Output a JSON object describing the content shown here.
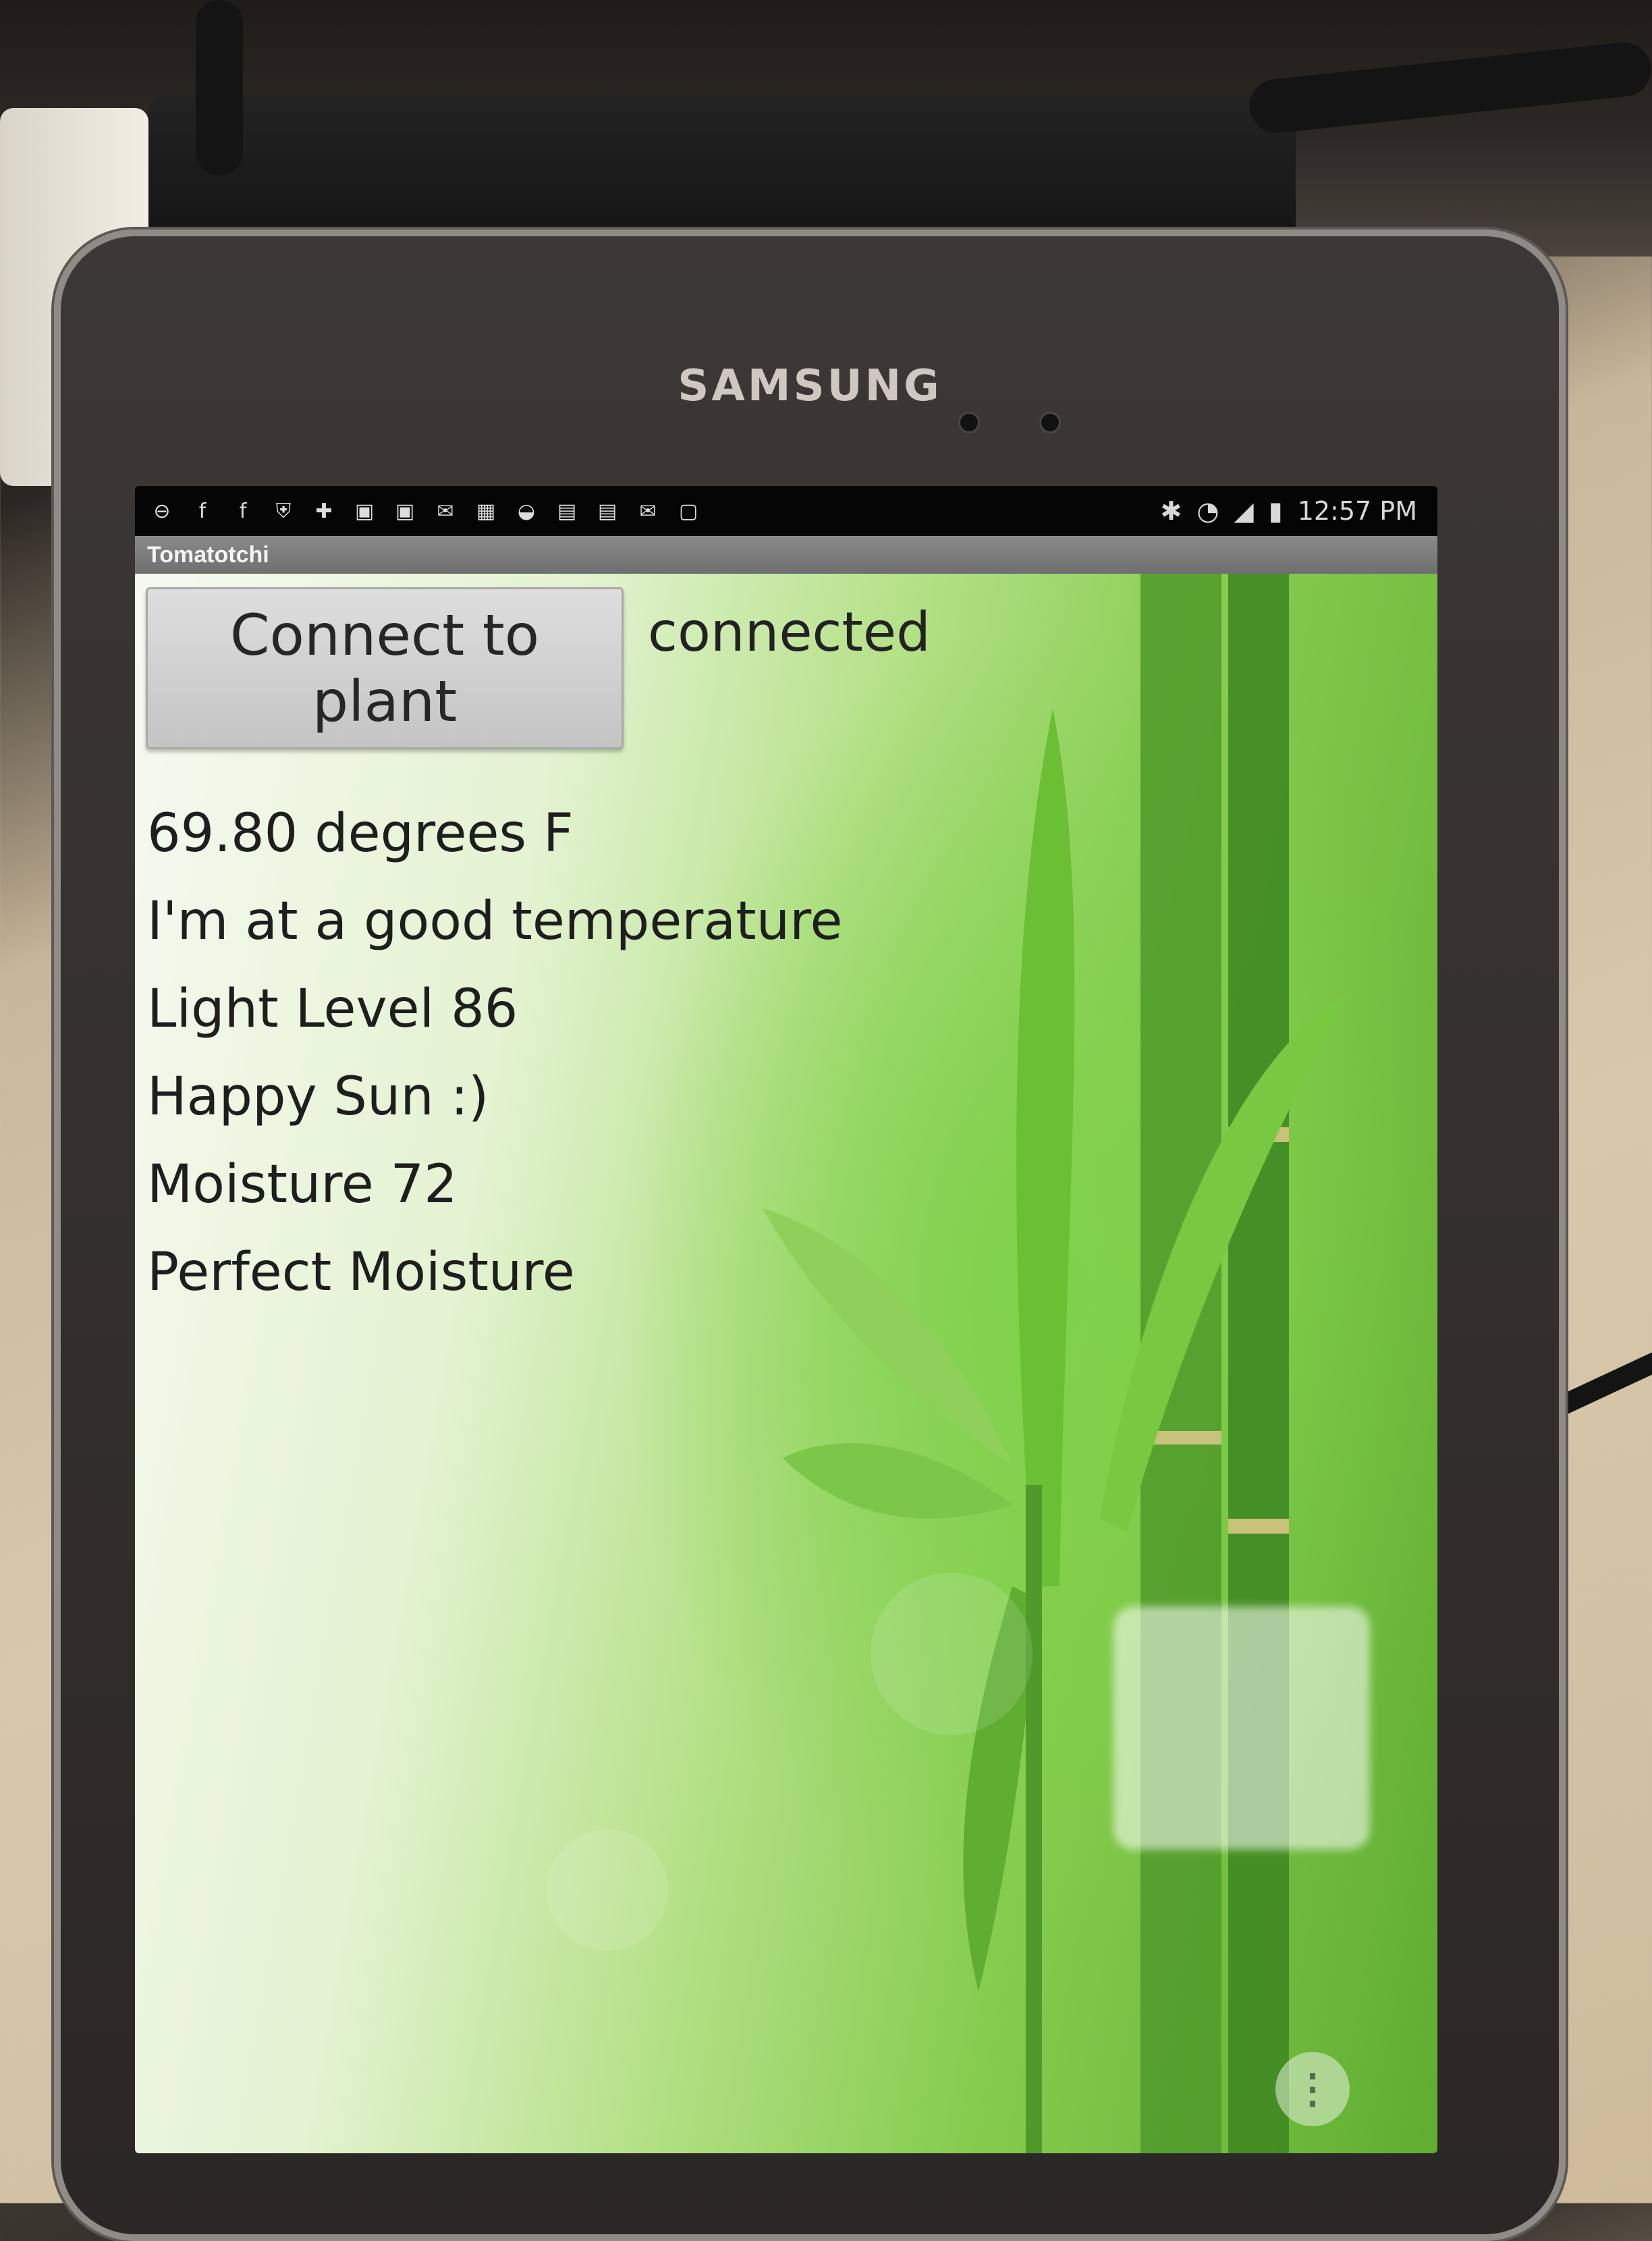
{
  "device": {
    "brand": "SAMSUNG"
  },
  "status_bar": {
    "notification_icons": [
      "minus-icon",
      "facebook-icon",
      "facebook-icon",
      "shield-icon",
      "plus-icon",
      "gallery-icon",
      "gallery-icon",
      "gmail-icon",
      "calendar-icon",
      "wifi-icon",
      "store-icon",
      "store-icon",
      "mail-icon",
      "briefcase-icon"
    ],
    "right_icons": [
      "bluetooth-icon",
      "wifi-icon",
      "signal-icon",
      "battery-icon"
    ],
    "time": "12:57 PM"
  },
  "app": {
    "title": "Tomatotchi",
    "connect_button_label": "Connect to plant",
    "connection_status": "connected",
    "readings": [
      "69.80 degrees F",
      "I'm at a good temperature",
      "Light Level 86",
      "Happy Sun :)",
      "Moisture 72",
      "Perfect Moisture"
    ]
  },
  "colors": {
    "accent_green": "#86cc4e",
    "button_gray": "#d2d2d2",
    "text": "#1e1e1e"
  }
}
